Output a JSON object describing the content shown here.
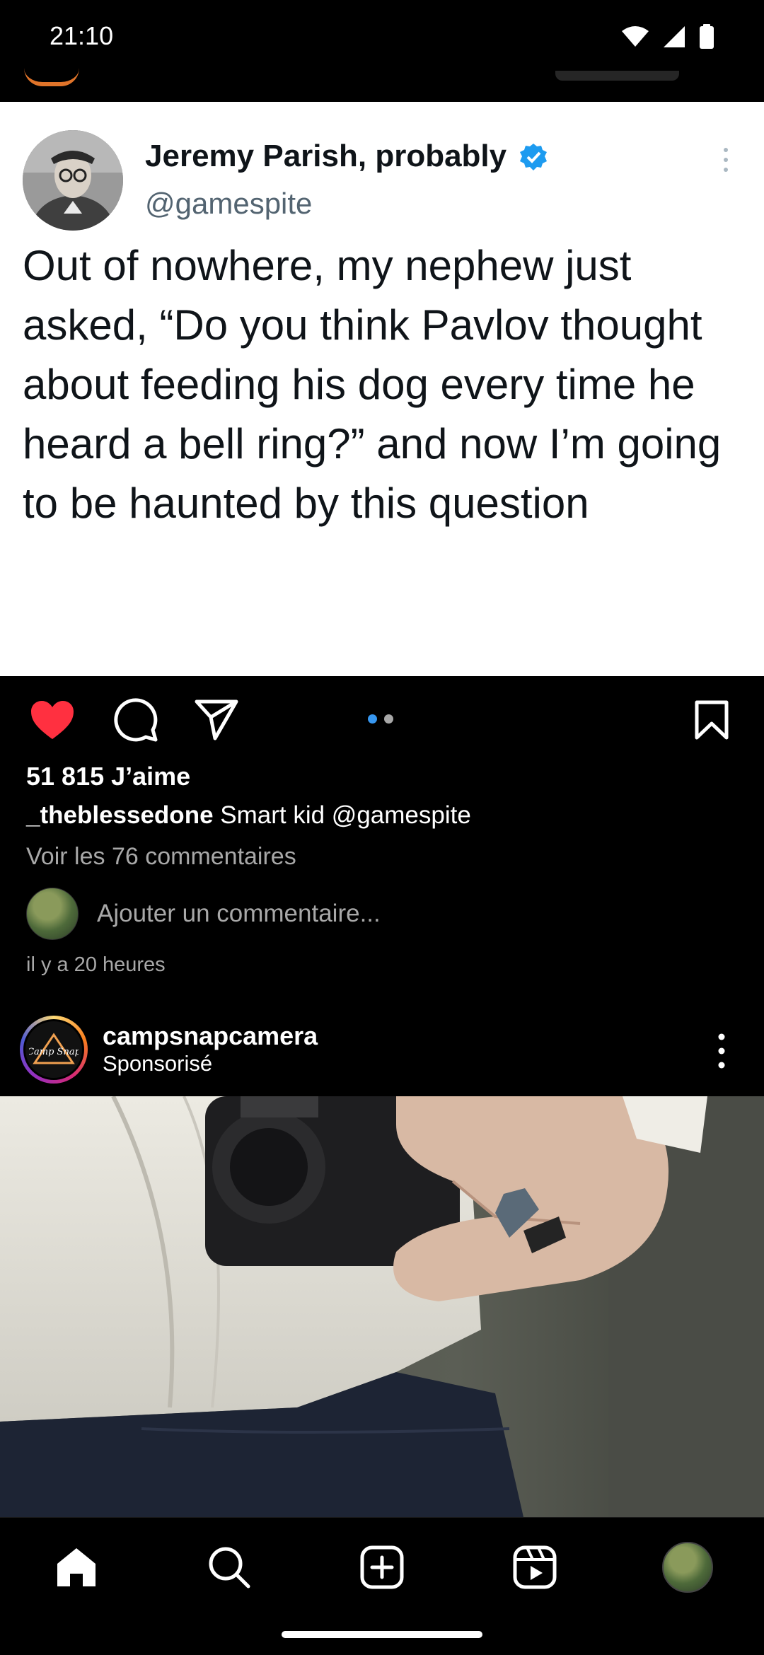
{
  "status_bar": {
    "time": "21:10",
    "icons": [
      "wifi-icon",
      "signal-icon",
      "battery-icon"
    ]
  },
  "tweet": {
    "name": "Jeremy Parish, probably",
    "handle": "@gamespite",
    "verified": true,
    "text": "Out of nowhere, my nephew just asked, “Do you think Pavlov thought about feeding his dog every time he heard a bell ring?” and now I’m going to be haunted by this question"
  },
  "post": {
    "liked": true,
    "likes": "51 815 J’aime",
    "caption_user": "_theblessedone",
    "caption_text": " Smart kid @gamespite",
    "view_comments": "Voir les 76 commentaires",
    "comment_placeholder": "Ajouter un commentaire...",
    "time": "il y a 20 heures",
    "carousel": {
      "total": 2,
      "active": 1
    }
  },
  "sponsored": {
    "username": "campsnapcamera",
    "label": "Sponsorisé",
    "avatar_logo_text": "Camp Snap"
  },
  "bottom_nav": {
    "items": [
      "home-icon",
      "search-icon",
      "create-icon",
      "reels-icon",
      "profile-avatar"
    ]
  },
  "colors": {
    "background": "#000000",
    "like_red": "#ff3040",
    "verified_blue": "#1d9bf0",
    "dot_active": "#3797f0",
    "muted_text": "#a8a8a8"
  }
}
